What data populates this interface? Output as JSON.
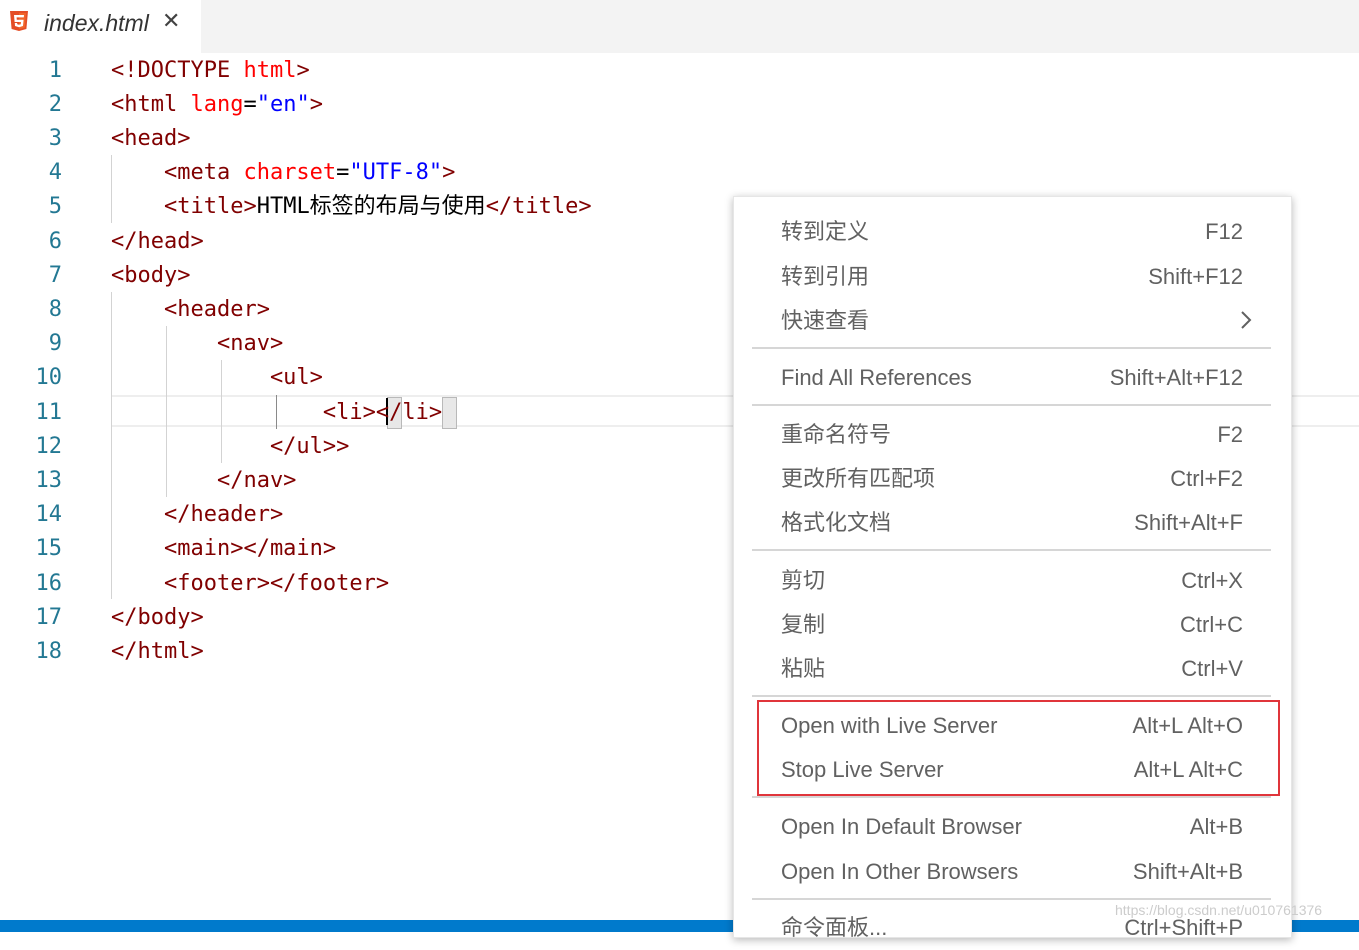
{
  "tab": {
    "title": "index.html",
    "close_glyph": "✕",
    "icon": "html5-icon"
  },
  "editor": {
    "lines": [
      {
        "num": "1",
        "segments": [
          {
            "t": "<!DOCTYPE ",
            "c": "tag"
          },
          {
            "t": "html",
            "c": "attr"
          },
          {
            "t": ">",
            "c": "tag"
          }
        ]
      },
      {
        "num": "2",
        "segments": [
          {
            "t": "<html ",
            "c": "tag"
          },
          {
            "t": "lang",
            "c": "attr"
          },
          {
            "t": "=",
            "c": "text"
          },
          {
            "t": "\"en\"",
            "c": "val"
          },
          {
            "t": ">",
            "c": "tag"
          }
        ]
      },
      {
        "num": "3",
        "segments": [
          {
            "t": "<head>",
            "c": "tag"
          }
        ]
      },
      {
        "num": "4",
        "segments": [
          {
            "t": "    <meta ",
            "c": "tag"
          },
          {
            "t": "charset",
            "c": "attr"
          },
          {
            "t": "=",
            "c": "text"
          },
          {
            "t": "\"UTF-8\"",
            "c": "val"
          },
          {
            "t": ">",
            "c": "tag"
          }
        ]
      },
      {
        "num": "5",
        "segments": [
          {
            "t": "    <title>",
            "c": "tag"
          },
          {
            "t": "HTML标签的布局与使用",
            "c": "text"
          },
          {
            "t": "</title>",
            "c": "tag"
          }
        ]
      },
      {
        "num": "6",
        "segments": [
          {
            "t": "</head>",
            "c": "tag"
          }
        ]
      },
      {
        "num": "7",
        "segments": [
          {
            "t": "<body>",
            "c": "tag"
          }
        ]
      },
      {
        "num": "8",
        "segments": [
          {
            "t": "    <header>",
            "c": "tag"
          }
        ]
      },
      {
        "num": "9",
        "segments": [
          {
            "t": "        <nav>",
            "c": "tag"
          }
        ]
      },
      {
        "num": "10",
        "segments": [
          {
            "t": "            <ul>",
            "c": "tag"
          }
        ]
      },
      {
        "num": "11",
        "segments": [
          {
            "t": "                <li></li>",
            "c": "tag"
          }
        ]
      },
      {
        "num": "12",
        "segments": [
          {
            "t": "            </ul>>",
            "c": "tag"
          }
        ]
      },
      {
        "num": "13",
        "segments": [
          {
            "t": "        </nav>",
            "c": "tag"
          }
        ]
      },
      {
        "num": "14",
        "segments": [
          {
            "t": "    </header>",
            "c": "tag"
          }
        ]
      },
      {
        "num": "15",
        "segments": [
          {
            "t": "    <main></main>",
            "c": "tag"
          }
        ]
      },
      {
        "num": "16",
        "segments": [
          {
            "t": "    <footer></footer>",
            "c": "tag"
          }
        ]
      },
      {
        "num": "17",
        "segments": [
          {
            "t": "</body>",
            "c": "tag"
          }
        ]
      },
      {
        "num": "18",
        "segments": [
          {
            "t": "</html>",
            "c": "tag"
          }
        ]
      }
    ]
  },
  "context_menu": {
    "items": [
      {
        "label": "转到定义",
        "key": "F12"
      },
      {
        "label": "转到引用",
        "key": "Shift+F12"
      },
      {
        "label": "快速查看",
        "key": "",
        "submenu": true,
        "icon": "chevron-right-icon"
      },
      {
        "label": "Find All References",
        "key": "Shift+Alt+F12"
      },
      {
        "label": "重命名符号",
        "key": "F2"
      },
      {
        "label": "更改所有匹配项",
        "key": "Ctrl+F2"
      },
      {
        "label": "格式化文档",
        "key": "Shift+Alt+F"
      },
      {
        "label": "剪切",
        "key": "Ctrl+X"
      },
      {
        "label": "复制",
        "key": "Ctrl+C"
      },
      {
        "label": "粘贴",
        "key": "Ctrl+V"
      },
      {
        "label": "Open with Live Server",
        "key": "Alt+L Alt+O"
      },
      {
        "label": "Stop Live Server",
        "key": "Alt+L Alt+C"
      },
      {
        "label": "Open In Default Browser",
        "key": "Alt+B"
      },
      {
        "label": "Open In Other Browsers",
        "key": "Shift+Alt+B"
      },
      {
        "label": "命令面板...",
        "key": "Ctrl+Shift+P"
      }
    ],
    "highlight_color": "#e0353b"
  },
  "colors": {
    "tag": "#800000",
    "attr": "#ff0000",
    "val": "#0000ff",
    "line_number": "#237893",
    "status_bar": "#007acc"
  },
  "watermark": "https://blog.csdn.net/u010761376"
}
